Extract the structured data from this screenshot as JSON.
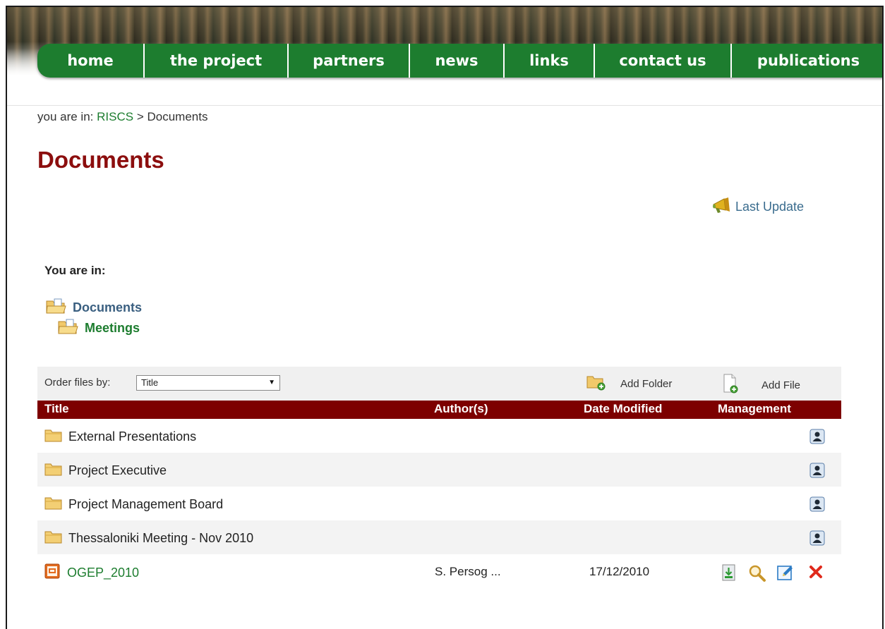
{
  "nav": {
    "items": [
      {
        "label": "home"
      },
      {
        "label": "the project"
      },
      {
        "label": "partners"
      },
      {
        "label": "news"
      },
      {
        "label": "links"
      },
      {
        "label": "contact us"
      },
      {
        "label": "publications"
      }
    ]
  },
  "breadcrumb": {
    "prefix": "you are in:",
    "link": "RISCS",
    "separator": ">",
    "current": "Documents"
  },
  "page": {
    "title": "Documents"
  },
  "last_update": {
    "label": "Last Update",
    "icon": "megaphone-icon"
  },
  "location": {
    "heading": "You are in:",
    "root": "Documents",
    "child": "Meetings"
  },
  "toolbar": {
    "order_label": "Order files by:",
    "order_value": "Title",
    "add_folder": "Add Folder",
    "add_file": "Add File"
  },
  "table": {
    "headers": {
      "title": "Title",
      "authors": "Author(s)",
      "date": "Date Modified",
      "management": "Management"
    },
    "rows": [
      {
        "type": "folder",
        "name": "External Presentations",
        "author": "",
        "date": ""
      },
      {
        "type": "folder",
        "name": "Project Executive",
        "author": "",
        "date": ""
      },
      {
        "type": "folder",
        "name": "Project Management Board",
        "author": "",
        "date": ""
      },
      {
        "type": "folder",
        "name": "Thessaloniki Meeting - Nov 2010",
        "author": "",
        "date": ""
      },
      {
        "type": "file",
        "name": "OGEP_2010",
        "author": "S. Persog ...",
        "date": "17/12/2010"
      }
    ]
  },
  "colors": {
    "nav_green": "#1d7d2f",
    "title_red": "#8c0e0e",
    "header_bar": "#7d0000",
    "link_blue": "#3a6c8e"
  }
}
